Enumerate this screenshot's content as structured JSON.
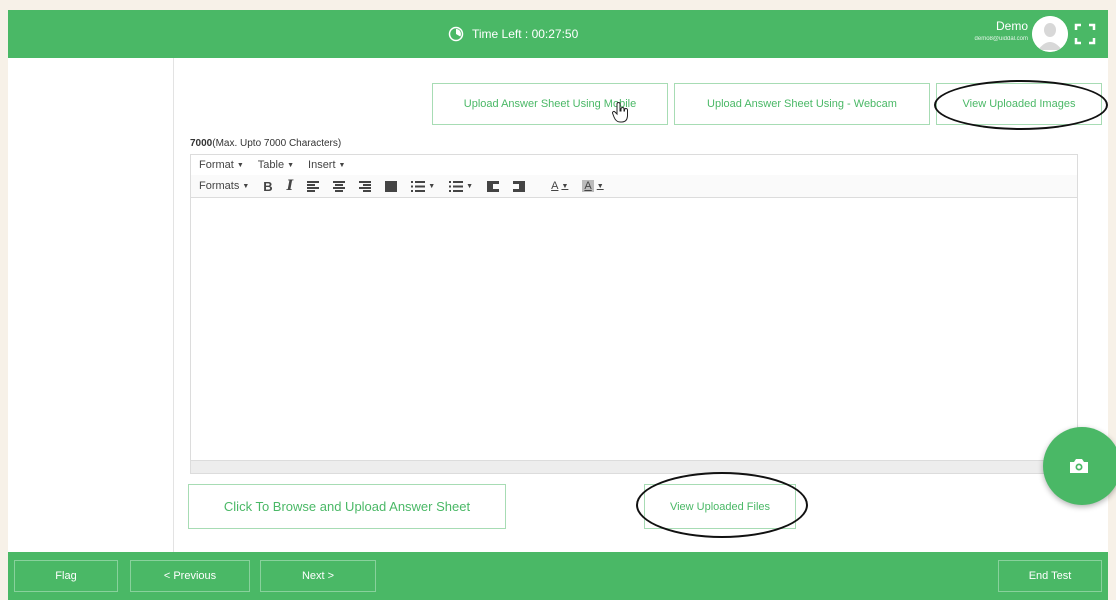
{
  "header": {
    "timer_label": "Time Left : 00:27:50",
    "user_name": "Demo",
    "user_email": "demo8@uiddal.com"
  },
  "upload_buttons": {
    "mobile": "Upload Answer Sheet Using Mobile",
    "webcam": "Upload Answer Sheet Using - Webcam",
    "view_images": "View Uploaded Images"
  },
  "char_limit": {
    "count": "7000",
    "hint": "(Max. Upto 7000 Characters)"
  },
  "editor": {
    "menus": [
      "Format",
      "Table",
      "Insert"
    ],
    "formats_label": "Formats",
    "bold": "B",
    "italic": "I",
    "text_color": "A",
    "bg_color": "A"
  },
  "browse_button": "Click To Browse and Upload Answer Sheet",
  "view_files_button": "View Uploaded Files",
  "footer": {
    "flag": "Flag",
    "previous": "< Previous",
    "next": "Next >",
    "end": "End Test"
  },
  "colors": {
    "accent": "#4ab866",
    "border_light": "#a7dcb4"
  },
  "icons": {
    "timer": "clock-icon",
    "fullscreen": "fullscreen-icon",
    "camera": "camera-icon",
    "cursor": "hand-cursor-icon"
  }
}
